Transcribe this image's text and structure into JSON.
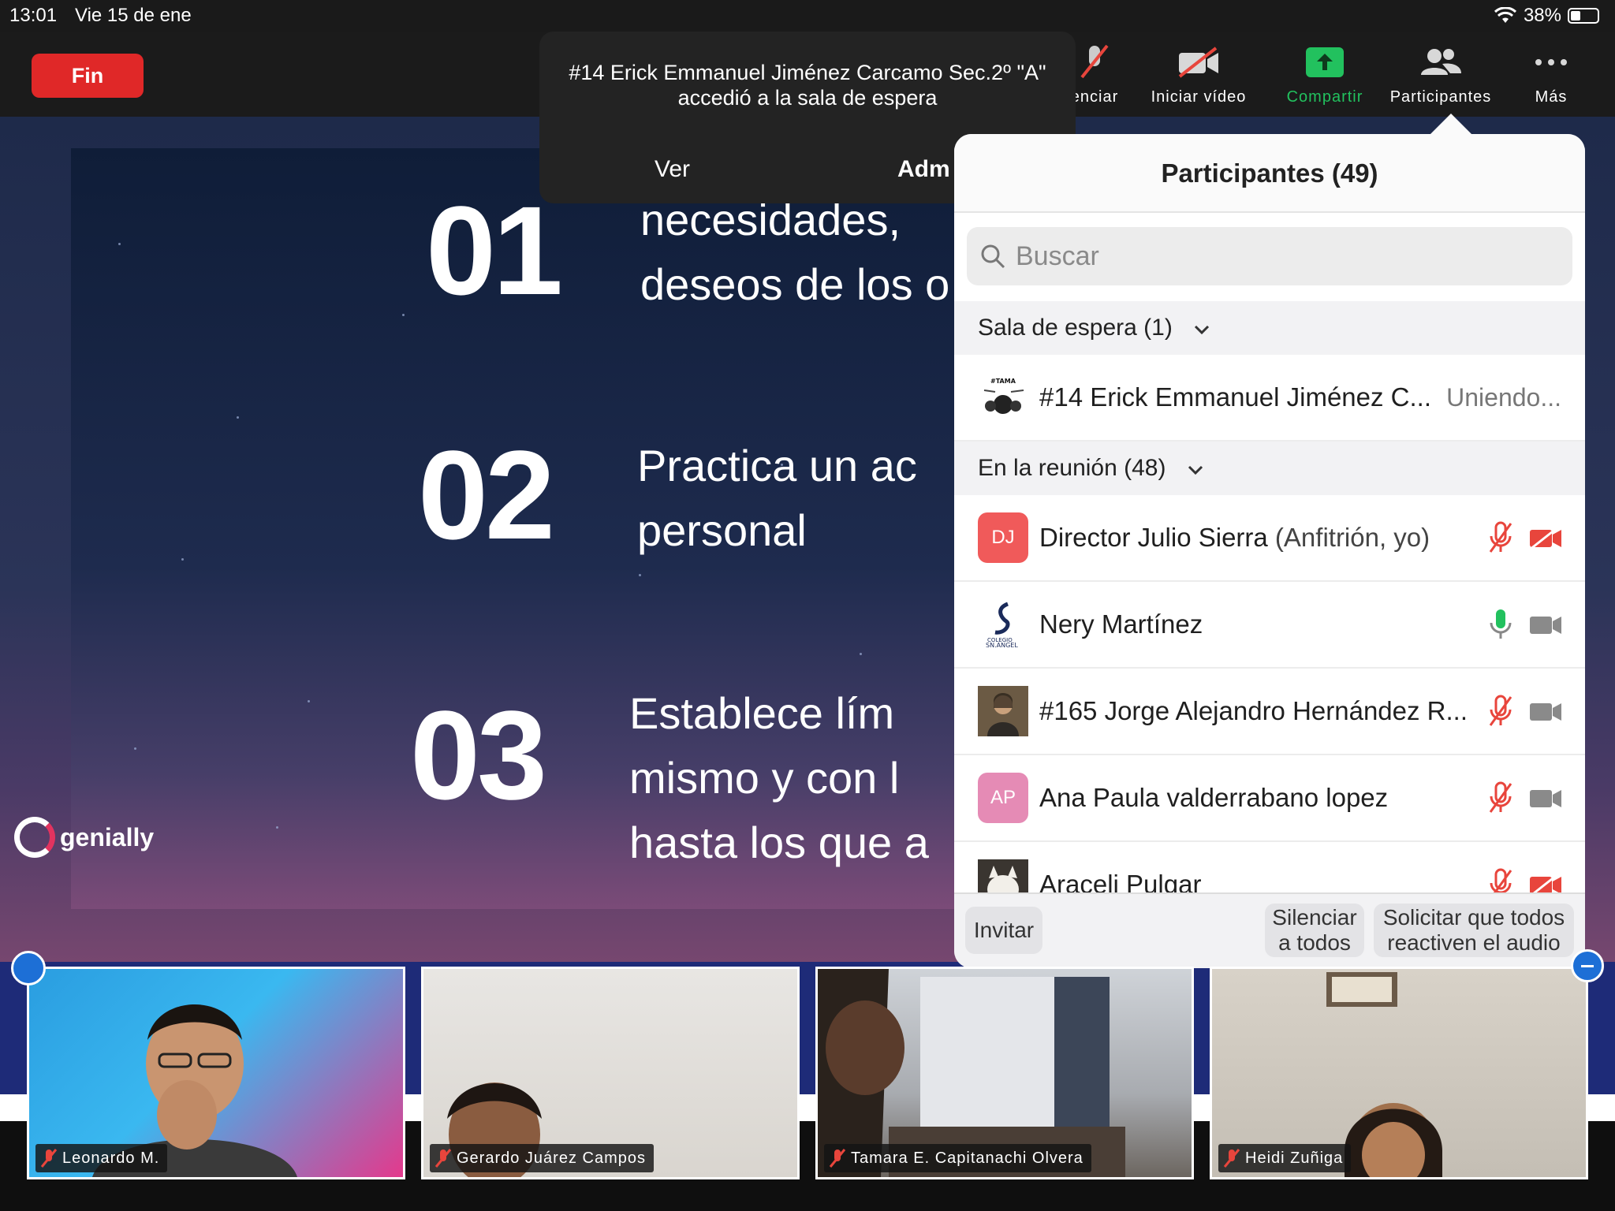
{
  "status_bar": {
    "time": "13:01",
    "date": "Vie 15 de ene",
    "battery": "38%",
    "battery_level": 0.38
  },
  "toolbar": {
    "end_label": "Fin",
    "mute_label": "enciar",
    "video_label": "Iniciar vídeo",
    "share_label": "Compartir",
    "participants_label": "Participantes",
    "more_label": "Más"
  },
  "notification": {
    "message": "#14 Erick Emmanuel Jiménez Carcamo Sec.2º \"A\" accedió a la sala de espera",
    "view_label": "Ver",
    "admit_label": "Adm"
  },
  "slide": {
    "items": [
      {
        "number": "01",
        "lines": [
          "necesidades,",
          "deseos de los o"
        ]
      },
      {
        "number": "02",
        "lines": [
          "Practica  un  ac",
          "personal"
        ]
      },
      {
        "number": "03",
        "lines": [
          "Establece    lím",
          "mismo  y  con  l",
          "hasta los que a"
        ]
      }
    ],
    "brand": "genially"
  },
  "participants_panel": {
    "title": "Participantes (49)",
    "search_placeholder": "Buscar",
    "waiting_room": {
      "header": "Sala de espera (1)",
      "items": [
        {
          "name": "#14 Erick Emmanuel Jiménez C...",
          "status": "Uniendo..."
        }
      ]
    },
    "in_meeting": {
      "header": "En la reunión (48)",
      "items": [
        {
          "initials": "DJ",
          "name": "Director Julio Sierra",
          "role": " (Anfitrión, yo)",
          "avatar_color": "#f05a5a",
          "mic": "muted",
          "video": "off"
        },
        {
          "initials": "",
          "name": "Nery Martínez",
          "role": "",
          "avatar_color": "#ffffff",
          "mic": "on",
          "video": "on"
        },
        {
          "initials": "",
          "name": "#165 Jorge Alejandro Hernández R...",
          "role": "",
          "avatar_color": "#5a4c3c",
          "mic": "muted",
          "video": "on"
        },
        {
          "initials": "AP",
          "name": "Ana Paula valderrabano lopez",
          "role": "",
          "avatar_color": "#e58bb5",
          "mic": "muted",
          "video": "on"
        },
        {
          "initials": "",
          "name": "Araceli Pulgar",
          "role": "",
          "avatar_color": "#e9e2d6",
          "mic": "muted",
          "video": "off"
        }
      ]
    },
    "footer": {
      "invite_label": "Invitar",
      "mute_all_line1": "Silenciar",
      "mute_all_line2": "a todos",
      "ask_unmute_line1": "Solicitar que todos",
      "ask_unmute_line2": "reactiven el audio"
    }
  },
  "video_tiles": [
    {
      "name": "Leonardo M."
    },
    {
      "name": "Gerardo Juárez Campos"
    },
    {
      "name": "Tamara E. Capitanachi Olvera"
    },
    {
      "name": "Heidi Zuñiga"
    }
  ],
  "colors": {
    "end_red": "#e02828",
    "share_green": "#22c15e",
    "mute_red": "#e8453c",
    "panel_bg": "#ffffff"
  }
}
